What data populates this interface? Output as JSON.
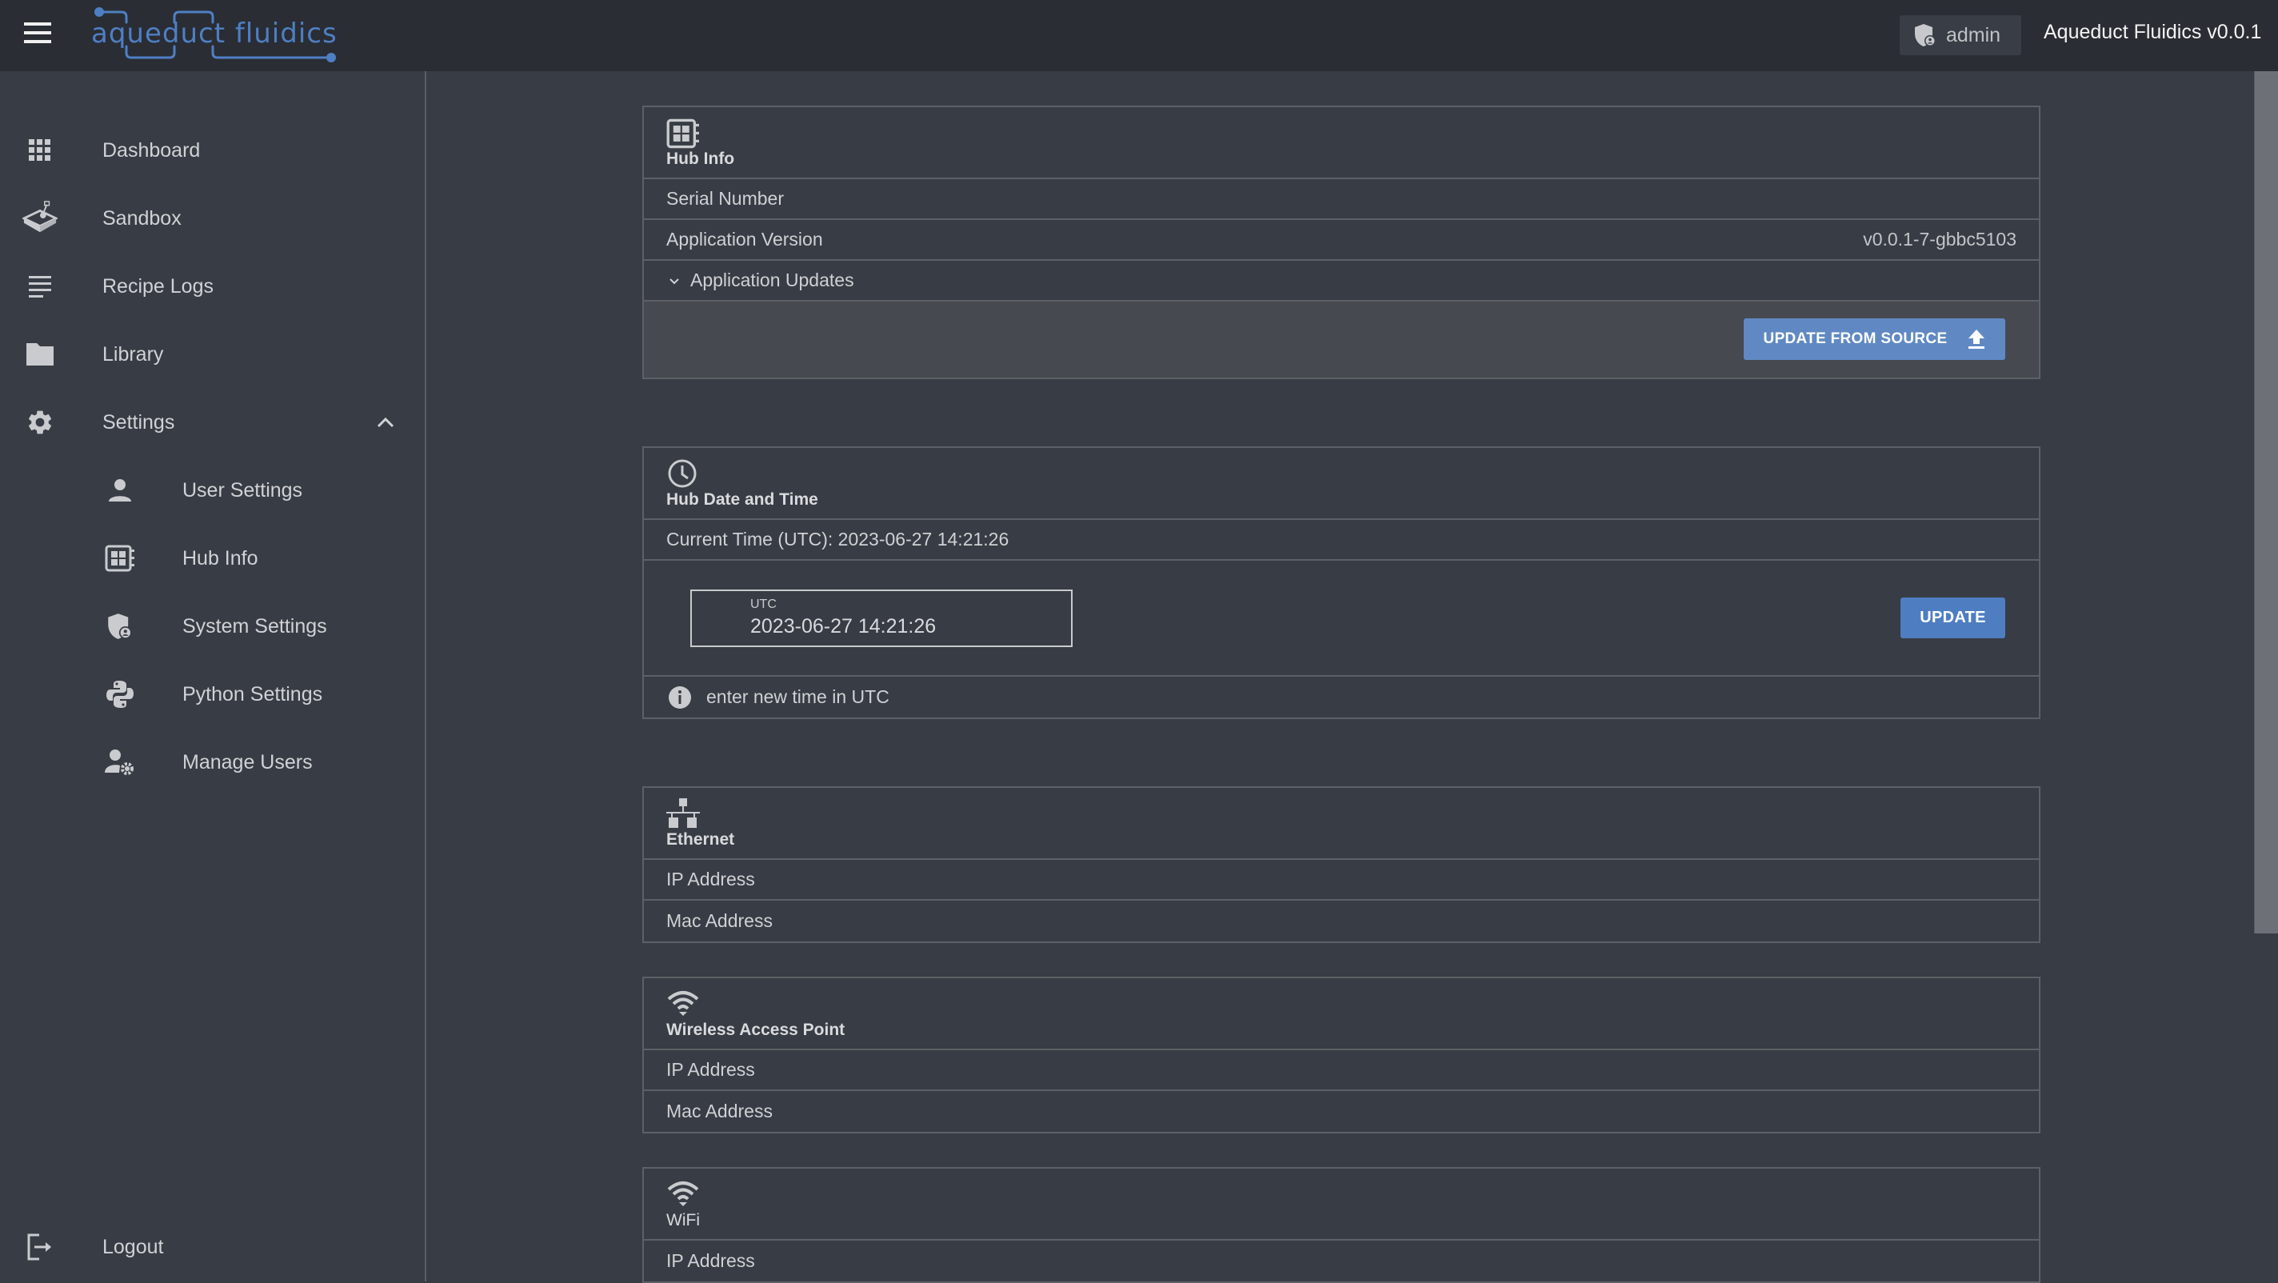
{
  "header": {
    "menu_icon": "hamburger-menu-icon",
    "logo_text": "aqueduct fluidics",
    "user_chip": {
      "icon": "admin-shield-icon",
      "label": "admin"
    },
    "app_title": "Aqueduct Fluidics v0.0.1"
  },
  "sidebar": {
    "items": [
      {
        "label": "Dashboard",
        "icon": "grid-icon"
      },
      {
        "label": "Sandbox",
        "icon": "sandbox-icon"
      },
      {
        "label": "Recipe Logs",
        "icon": "list-icon"
      },
      {
        "label": "Library",
        "icon": "folder-icon"
      },
      {
        "label": "Settings",
        "icon": "gear-icon",
        "expanded": true
      }
    ],
    "settings_children": [
      {
        "label": "User Settings",
        "icon": "person-icon"
      },
      {
        "label": "Hub Info",
        "icon": "hub-icon"
      },
      {
        "label": "System Settings",
        "icon": "admin-shield-icon"
      },
      {
        "label": "Python Settings",
        "icon": "python-icon"
      },
      {
        "label": "Manage Users",
        "icon": "manage-users-icon"
      }
    ],
    "logout": {
      "label": "Logout",
      "icon": "logout-icon"
    }
  },
  "hub_info": {
    "title": "Hub Info",
    "icon": "hub-icon",
    "rows": [
      {
        "label": "Serial Number",
        "value": ""
      },
      {
        "label": "Application Version",
        "value": "v0.0.1-7-gbbc5103"
      }
    ],
    "updates_label": "Application Updates",
    "update_button": "UPDATE FROM SOURCE"
  },
  "date_time": {
    "title": "Hub Date and Time",
    "icon": "clock-icon",
    "current_time": "Current Time (UTC): 2023-06-27 14:21:26",
    "field_label": "UTC",
    "field_value": "2023-06-27 14:21:26",
    "update_button": "UPDATE",
    "hint": "enter new time in UTC"
  },
  "ethernet": {
    "title": "Ethernet",
    "icon": "ethernet-icon",
    "rows": [
      {
        "label": "IP Address",
        "value": ""
      },
      {
        "label": "Mac Address",
        "value": ""
      }
    ]
  },
  "wap": {
    "title": "Wireless Access Point",
    "icon": "wifi-icon",
    "rows": [
      {
        "label": "IP Address",
        "value": ""
      },
      {
        "label": "Mac Address",
        "value": ""
      }
    ]
  },
  "wifi": {
    "title": "WiFi",
    "icon": "wifi-icon",
    "rows": [
      {
        "label": "IP Address",
        "value": ""
      }
    ]
  },
  "colors": {
    "header_bg": "#2a2d33",
    "page_bg": "#383c44",
    "accent": "#5f88c4",
    "logo_blue": "#4e7fc4"
  }
}
